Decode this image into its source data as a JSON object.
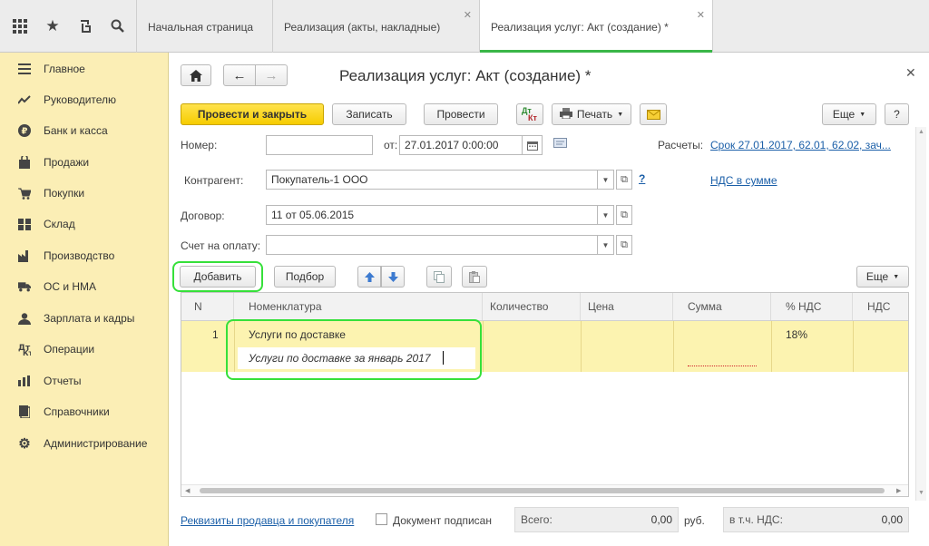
{
  "topbar": {
    "icons": [
      "apps-grid-icon",
      "star-icon",
      "history-icon",
      "search-icon"
    ],
    "tabs": [
      {
        "label": "Начальная страница",
        "closable": false
      },
      {
        "label": "Реализация (акты, накладные)",
        "closable": true
      },
      {
        "label": "Реализация услуг: Акт (создание) *",
        "closable": true,
        "active": true
      }
    ]
  },
  "sidebar": {
    "items": [
      {
        "label": "Главное",
        "icon": "menu-icon"
      },
      {
        "label": "Руководителю",
        "icon": "trend-icon"
      },
      {
        "label": "Банк и касса",
        "icon": "ruble-icon"
      },
      {
        "label": "Продажи",
        "icon": "bag-icon"
      },
      {
        "label": "Покупки",
        "icon": "cart-icon"
      },
      {
        "label": "Склад",
        "icon": "warehouse-icon"
      },
      {
        "label": "Производство",
        "icon": "factory-icon"
      },
      {
        "label": "ОС и НМА",
        "icon": "truck-icon"
      },
      {
        "label": "Зарплата и кадры",
        "icon": "people-icon"
      },
      {
        "label": "Операции",
        "icon": "operations-icon"
      },
      {
        "label": "Отчеты",
        "icon": "report-icon"
      },
      {
        "label": "Справочники",
        "icon": "book-icon"
      },
      {
        "label": "Администрирование",
        "icon": "gear-icon"
      }
    ]
  },
  "form": {
    "title": "Реализация услуг: Акт (создание) *",
    "toolbar": {
      "post_close": "Провести и закрыть",
      "save": "Записать",
      "post": "Провести",
      "print": "Печать",
      "more": "Еще",
      "help": "?",
      "dtkt_top": "Дт",
      "dtkt_bottom": "Кт"
    },
    "number_label": "Номер:",
    "number_value": "",
    "date_label": "от:",
    "date_value": "27.01.2017  0:00:00",
    "settlements_label": "Расчеты:",
    "settlements_link": "Срок 27.01.2017, 62.01, 62.02, зач...",
    "contractor_label": "Контрагент:",
    "contractor_value": "Покупатель-1 ООО",
    "help_mark": "?",
    "vat_link": "НДС в сумме",
    "contract_label": "Договор:",
    "contract_value": "11 от 05.06.2015",
    "invoice_label": "Счет на оплату:",
    "invoice_value": "",
    "table_toolbar": {
      "add": "Добавить",
      "select": "Подбор",
      "more": "Еще"
    }
  },
  "table": {
    "columns": [
      "N",
      "Номенклатура",
      "Количество",
      "Цена",
      "Сумма",
      "% НДС",
      "НДС"
    ],
    "rows": [
      {
        "n": "1",
        "item": "Услуги по доставке",
        "content": "Услуги по доставке за январь 2017",
        "qty": "",
        "price": "",
        "sum": "",
        "vat_rate": "18%",
        "vat": ""
      }
    ]
  },
  "footer": {
    "requisites_link": "Реквизиты продавца и покупателя",
    "signed_label": "Документ подписан",
    "total_label": "Всего:",
    "total_value": "0,00",
    "currency": "руб.",
    "vat_label": "в т.ч. НДС:",
    "vat_value": "0,00"
  },
  "colors": {
    "sidebar_bg": "#fbeeb5",
    "primary_button": "#f6cc00",
    "active_tab_accent": "#3ab648",
    "highlight": "#36e03a",
    "selected_row": "#fcf3b0",
    "link": "#1b5fa8"
  }
}
